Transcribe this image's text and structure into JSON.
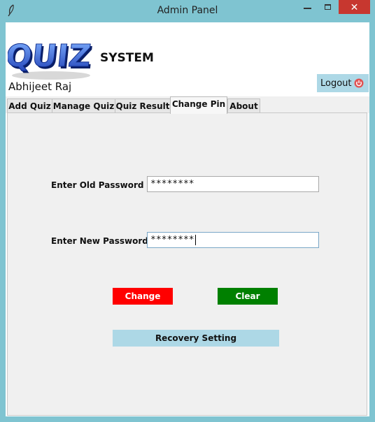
{
  "window": {
    "title": "Admin Panel",
    "close_label": "✕",
    "icons": {
      "app": "feather-icon",
      "minimize": "minimize-icon",
      "maximize": "maximize-icon",
      "close": "close-icon"
    }
  },
  "header": {
    "logo_text": "QUIZ!",
    "system_label": "SYSTEM",
    "user_name": "Abhijeet Raj",
    "logout_label": "Logout",
    "logout_icon": "power-icon"
  },
  "tabs": [
    {
      "label": "Add Quiz"
    },
    {
      "label": "Manage Quiz"
    },
    {
      "label": "Quiz Result"
    },
    {
      "label": "Change Pin",
      "active": true
    },
    {
      "label": "About"
    }
  ],
  "form": {
    "old_password_label": "Enter Old Password",
    "old_password_value": "********",
    "new_password_label": "Enter New Password",
    "new_password_value": "********",
    "change_label": "Change",
    "clear_label": "Clear",
    "recovery_label": "Recovery Setting"
  },
  "colors": {
    "window_frame": "#7fc4d1",
    "close_button": "#c7372f",
    "change_button": "#ff0000",
    "clear_button": "#008000",
    "light_blue_button": "#add8e6",
    "panel_bg": "#f0f0f0"
  }
}
